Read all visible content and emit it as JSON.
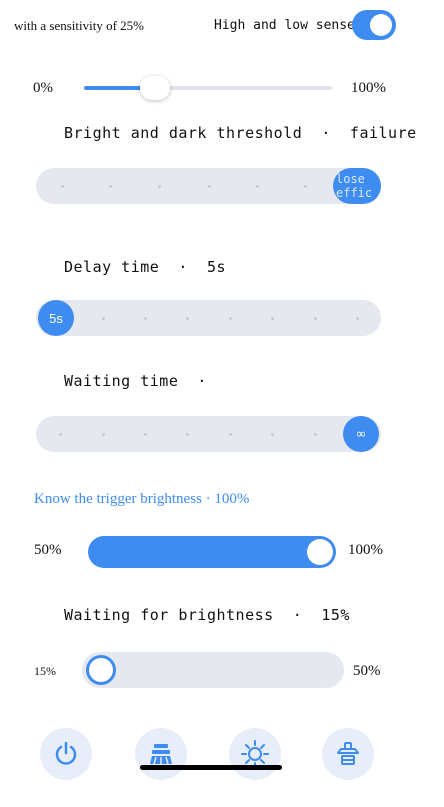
{
  "header": {
    "sensitivity_text": "with a sensitivity of 25%",
    "high_low_label": "High and low sense",
    "toggle_on": true
  },
  "sensitivity_slider": {
    "min_label": "0%",
    "max_label": "100%",
    "value_percent": 25
  },
  "bright_dark": {
    "title": "Bright and dark threshold  ·  failure",
    "bubble_text": "lose effic",
    "steps": 8,
    "selected_index": 7
  },
  "delay": {
    "title": "Delay time  ·  5s",
    "bubble_text": "5s",
    "steps": 8,
    "selected_index": 0
  },
  "waiting_time": {
    "title": "Waiting time  ·",
    "bubble_text": "∞",
    "steps": 8,
    "selected_index": 7
  },
  "trigger_brightness": {
    "title": "Know the trigger brightness · 100%",
    "min_label": "50%",
    "max_label": "100%",
    "value_percent": 100
  },
  "waiting_brightness": {
    "title": "Waiting for brightness  ·  15%",
    "min_label": "15%",
    "max_label": "50%",
    "value_percent": 15
  },
  "nav": {
    "items": [
      "power-icon",
      "mode-icon",
      "brightness-icon",
      "lamp-icon"
    ]
  },
  "colors": {
    "accent": "#3f8cf0",
    "track": "#e5e8ef"
  }
}
